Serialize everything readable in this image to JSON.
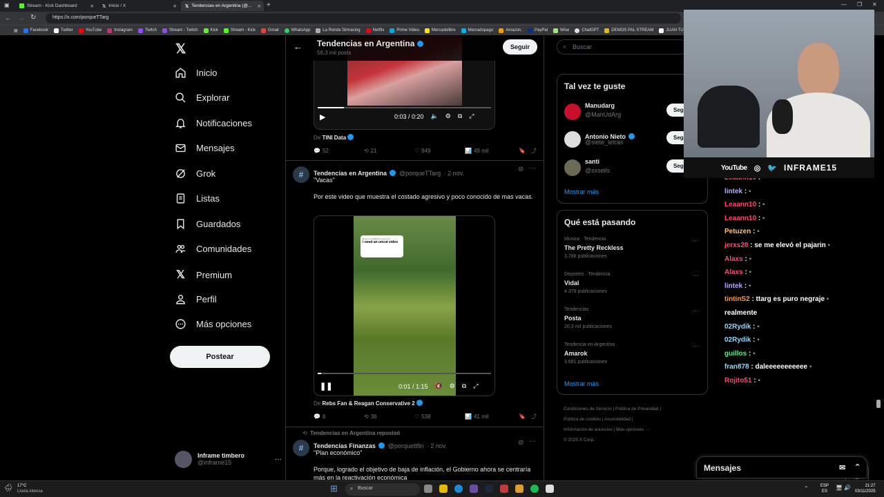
{
  "browser": {
    "tabs": [
      {
        "label": "Stream - Kick Dashboard",
        "color": "#53fc18"
      },
      {
        "label": "Inicio / X",
        "color": "#ffffff"
      },
      {
        "label": "Tendencias en Argentina (@...",
        "color": "#ffffff"
      }
    ],
    "url": "https://x.com/porqueTTarg",
    "bookmarks": [
      "Facebook",
      "Twitter",
      "YouTube",
      "Instagram",
      "Twitch",
      "Stream - Twitch",
      "Kick",
      "Stream - Kick",
      "Gmail",
      "WhatsApp",
      "La Ronda Simracing",
      "Netflix",
      "Prime Video",
      "Mercadolibre",
      "Mercadopago",
      "Amazon.",
      "PayPal",
      "Wise",
      "ChatGPT",
      "DEMOS PAL STREAM",
      "JUAN TUR"
    ]
  },
  "nav": {
    "items": [
      "Inicio",
      "Explorar",
      "Notificaciones",
      "Mensajes",
      "Grok",
      "Listas",
      "Guardados",
      "Comunidades",
      "Premium",
      "Perfil",
      "Más opciones"
    ],
    "post_button": "Postear",
    "user_name": "Inframe timbero",
    "user_handle": "@inframe15"
  },
  "header": {
    "title": "Tendencias en Argentina",
    "subtitle": "56,3 mil posts",
    "follow_label": "Seguir"
  },
  "tweet1": {
    "video_time": "0:03 / 0:20",
    "progress": 0.15,
    "source_prefix": "De",
    "source": "TINI Data",
    "replies": "52",
    "retweets": "21",
    "likes": "949",
    "views": "49 mil"
  },
  "tweet2": {
    "name": "Tendencias en Argentina",
    "handle": "@porqueTTarg",
    "date": "· 2 nov.",
    "quote": "\"Vacas\"",
    "text": "Por este video que muestra el costado agresivo y poco conocido de mas vacas.",
    "overlay_small": "Reply to timeBrick's comment",
    "overlay_text": "i need an uncut video",
    "video_time": "0:01 / 1:15",
    "progress": 0.02,
    "source_prefix": "De",
    "source": "Rebs Fan & Reagan Conservative 2",
    "replies": "6",
    "retweets": "36",
    "likes": "538",
    "views": "41 mil"
  },
  "tweet3": {
    "repost_label": "Tendencias en Argentina reposteó",
    "name": "Tendencias Finanzas",
    "handle": "@porquettfin",
    "date": "· 2 nov.",
    "quote": "\"Plan económico\"",
    "text": "Porque, logrado el objetivo de baja de inflación, el Gobierno ahora se centraría más en la reactivación económica"
  },
  "right": {
    "search_placeholder": "Buscar",
    "suggest_title": "Tal vez te guste",
    "suggestions": [
      {
        "name": "Manudarg",
        "handle": "@ManUdArg",
        "button": "Seg",
        "avatar_color": "#c8102e"
      },
      {
        "name": "Antonio Nieto",
        "handle": "@siete_letras",
        "button": "Seg",
        "avatar_color": "#dddddd"
      },
      {
        "name": "santi",
        "handle": "@sxseils",
        "button": "Seg",
        "avatar_color": "#6a6a55"
      }
    ],
    "show_more": "Mostrar más",
    "trends_title": "Qué está pasando",
    "trends": [
      {
        "category": "Música · Tendencia",
        "name": "The Pretty Reckless",
        "count": "3.788 publicaciones"
      },
      {
        "category": "Deportes · Tendencia",
        "name": "Vidal",
        "count": "4.379 publicaciones"
      },
      {
        "category": "Tendencias",
        "name": "Posta",
        "count": "20,3 mil publicaciones"
      },
      {
        "category": "Tendencia en Argentina",
        "name": "Amarok",
        "count": "3.681 publicaciones"
      }
    ],
    "trends_more": "Mostrar más",
    "footer1": "Condiciones de Servicio  |  Política de Privacidad  |",
    "footer2": "Política de cookies  |  Accesibilidad  |",
    "footer3": "Información de anuncios  |  Más opciones ···",
    "footer4": "© 2025 X Corp."
  },
  "overlay": {
    "youtube": "YouTube",
    "brand": "INFRAME15"
  },
  "chat": [
    {
      "user": "Leaann10",
      "msg": ":",
      "color": "#ff4a6e"
    },
    {
      "user": "lintek",
      "msg": ":",
      "color": "#b9a6ff"
    },
    {
      "user": "Leaann10",
      "msg": ":",
      "color": "#ff4a6e"
    },
    {
      "user": "Leaann10",
      "msg": ":",
      "color": "#ff4a6e"
    },
    {
      "user": "Petuzen",
      "msg": ":",
      "color": "#ffc56b"
    },
    {
      "user": "jerxs28",
      "msg": ": se me elevó el pajarin",
      "color": "#ff4a6e"
    },
    {
      "user": "Alaxs",
      "msg": ":",
      "color": "#ff4a6e"
    },
    {
      "user": "Alaxs",
      "msg": ":",
      "color": "#ff4a6e"
    },
    {
      "user": "lintek",
      "msg": ":",
      "color": "#b9a6ff"
    },
    {
      "user": "tintinS2",
      "msg": ": ttarg es puro negraje",
      "color": "#ff9a3c"
    },
    {
      "user": "",
      "msg": "realmente",
      "color": "#ffffff"
    },
    {
      "user": "02Rydik",
      "msg": ":",
      "color": "#8fd7ff"
    },
    {
      "user": "02Rydik",
      "msg": ":",
      "color": "#8fd7ff"
    },
    {
      "user": "guillos",
      "msg": ":",
      "color": "#5bf08a"
    },
    {
      "user": "fran878",
      "msg": ": daleeeeeeeeeee",
      "color": "#8fd7ff"
    },
    {
      "user": "Rojito51",
      "msg": ":",
      "color": "#ff4a6e"
    }
  ],
  "messages_drawer": "Mensajes",
  "taskbar": {
    "weather_temp": "17°C",
    "weather_desc": "Lluvia intensa",
    "search": "Buscar",
    "lang1": "ESP",
    "lang2": "ES",
    "time": "21:27",
    "date": "03/11/2025"
  }
}
